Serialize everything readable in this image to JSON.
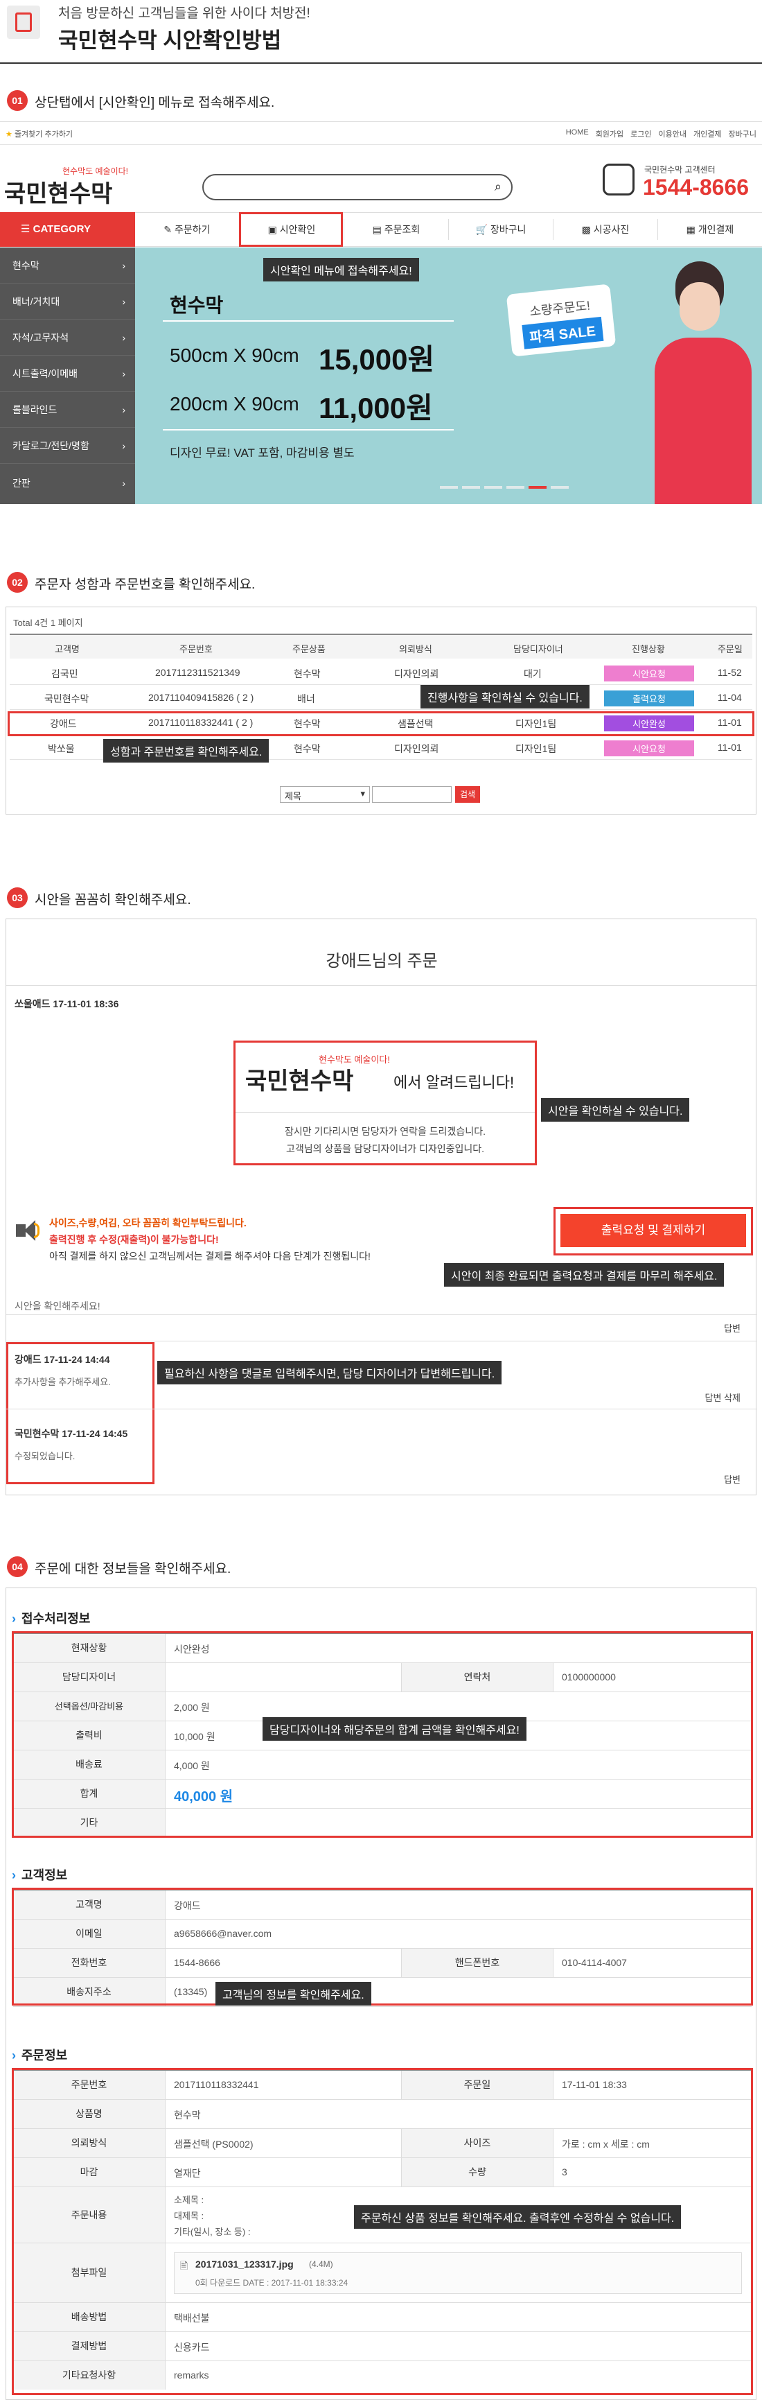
{
  "header": {
    "subtitle": "처음 방문하신 고객님들을 위한 사이다 처방전!",
    "title": "국민현수막 시안확인방법"
  },
  "steps": [
    {
      "num": "01",
      "text": "상단탭에서 [시안확인] 메뉴로 접속해주세요."
    },
    {
      "num": "02",
      "text": "주문자 성함과 주문번호를 확인해주세요."
    },
    {
      "num": "03",
      "text": "시안을 꼼꼼히 확인해주세요."
    },
    {
      "num": "04",
      "text": "주문에 대한 정보들을 확인해주세요."
    }
  ],
  "site": {
    "bookmark": "즐겨찾기 추가하기",
    "top_links": [
      "HOME",
      "회원가입",
      "로그인",
      "이용안내",
      "개인결제",
      "장바구니"
    ],
    "logo_tag": "현수막도 예술이다!",
    "logo_text": "국민현수막",
    "search_placeholder": "",
    "cs_label": "국민현수막 고객센터",
    "cs_phone": "1544-8666",
    "category_btn": "CATEGORY",
    "nav": [
      "주문하기",
      "시안확인",
      "주문조회",
      "장바구니",
      "시공사진",
      "개인결제"
    ],
    "categories": [
      "현수막",
      "배너/거치대",
      "자석/고무자석",
      "시트출력/이메배",
      "롤블라인드",
      "카달로그/전단/명함",
      "간판"
    ],
    "callout": "시안확인 메뉴에 접속해주세요!",
    "banner": {
      "title": "현수막",
      "line1_size": "500cm X 90cm",
      "line1_price": "15,000원",
      "line2_size": "200cm X 90cm",
      "line2_price": "11,000원",
      "note": "디자인 무료! VAT 포함, 마감비용 별도",
      "bubble1": "소량주문도!",
      "bubble2": "파격 SALE"
    }
  },
  "orders": {
    "total": "Total 4건 1 페이지",
    "headers": [
      "고객명",
      "주문번호",
      "주문상품",
      "의뢰방식",
      "담당디자이너",
      "진행상황",
      "주문일"
    ],
    "rows": [
      {
        "name": "김국민",
        "no": "2017112311521349",
        "product": "현수막",
        "method": "디자인의뢰",
        "designer": "대기",
        "status": "시안요청",
        "date": "11-52",
        "color": "#ee7ecf"
      },
      {
        "name": "국민현수막",
        "no": "2017110409415826 ( 2 )",
        "product": "배너",
        "method": "",
        "designer": "",
        "status": "출력요청",
        "date": "11-04",
        "color": "#3aa0d6"
      },
      {
        "name": "강애드",
        "no": "2017110118332441 ( 2 )",
        "product": "현수막",
        "method": "샘플선택",
        "designer": "디자인1팀",
        "status": "시안완성",
        "date": "11-01",
        "color": "#a24ee0"
      },
      {
        "name": "박쏘울",
        "no": "",
        "product": "현수막",
        "method": "디자인의뢰",
        "designer": "디자인1팀",
        "status": "시안요청",
        "date": "11-01",
        "color": "#ee7ecf"
      }
    ],
    "callout_progress": "진행사항을 확인하실 수 있습니다.",
    "callout_name": "성함과 주문번호를 확인해주세요.",
    "select_value": "제목",
    "search_btn": "검색"
  },
  "proof": {
    "title": "강애드님의 주문",
    "author": "쏘울애드  17-11-01 18:36",
    "notice_tag": "현수막도 예술이다!",
    "notice_logo": "국민현수막",
    "notice_suffix": "에서 알려드립니다!",
    "notice1": "잠시만 기다리시면 담당자가 연락을 드리겠습니다.",
    "notice2": "고객님의 상품을 담당디자이너가 디자인중입니다.",
    "callout_view": "시안을 확인하실 수 있습니다.",
    "warn1": "사이즈,수량,여김, 오타 꼼꼼히 확인부탁드립니다.",
    "warn2": "출력진행 후 수정(재출력)이 불가능합니다!",
    "warn3": "아직 결제를 하지 않으신 고객님께서는 결제를 해주셔야 다음 단계가 진행됩니다!",
    "pay_btn": "출력요청 및 결제하기",
    "callout_pay": "시안이 최종 완료되면 출력요청과 결제를 마무리 해주세요.",
    "confirm": "시안을 확인해주세요!",
    "reply": "답변",
    "c1_author": "강애드  17-11-24 14:44",
    "c1_text": "추가사항을 추가해주세요.",
    "callout_comment": "필요하신 사항을 댓글로 입력해주시면, 담당 디자이너가 답변해드립니다.",
    "reply_delete": "답변 삭제",
    "c2_author": "국민현수막  17-11-24 14:45",
    "c2_text": "수정되었습니다."
  },
  "info": {
    "sec1": "접수처리정보",
    "status_l": "현재상황",
    "status_v": "시안완성",
    "designer_l": "담당디자이너",
    "contact_l": "연락처",
    "contact_v": "0100000000",
    "sample_l": "선택옵션/마감비용",
    "sample_v": "2,000 원",
    "print_l": "출력비",
    "print_v": "10,000 원",
    "ship_l": "배송료",
    "ship_v": "4,000 원",
    "total_l": "합계",
    "total_v": "40,000 원",
    "etc_l": "기타",
    "callout_total": "담당디자이너와 해당주문의 합계 금액을 확인해주세요!",
    "sec2": "고객정보",
    "cust_l": "고객명",
    "cust_v": "강애드",
    "email_l": "이메일",
    "email_v": "a9658666@naver.com",
    "tel_l": "전화번호",
    "tel_v": "1544-8666",
    "hp_l": "핸드폰번호",
    "hp_v": "010-4114-4007",
    "addr_l": "배송지주소",
    "addr_v": "(13345)",
    "callout_cust": "고객님의 정보를 확인해주세요.",
    "sec3": "주문정보",
    "ono_l": "주문번호",
    "ono_v": "2017110118332441",
    "odate_l": "주문일",
    "odate_v": "17-11-01 18:33",
    "prod_l": "상품명",
    "prod_v": "현수막",
    "method_l": "의뢰방식",
    "method_v": "샘플선택 (PS0002)",
    "size_l": "사이즈",
    "size_v": "가로 : cm x 세로 : cm",
    "finish_l": "마감",
    "finish_v": "열재단",
    "qty_l": "수량",
    "qty_v": "3",
    "content_l": "주문내용",
    "content1": "소제목 :",
    "content2": "대제목 :",
    "content3": "기타(일시, 장소 등) :",
    "callout_order": "주문하신 상품 정보를 확인해주세요. 출력후엔 수정하실 수 없습니다.",
    "file_l": "첨부파일",
    "file_name": "20171031_123317.jpg",
    "file_size": "(4.4M)",
    "file_meta": "0회 다운로드 DATE : 2017-11-01 18:33:24",
    "deliv_l": "배송방법",
    "deliv_v": "택배선불",
    "pay_l": "결제방법",
    "pay_v": "신용카드",
    "req_l": "기타요청사항",
    "req_v": "remarks"
  },
  "colors": {
    "accent": "#e53935",
    "blue": "#1e88e5",
    "dark": "#333333"
  }
}
